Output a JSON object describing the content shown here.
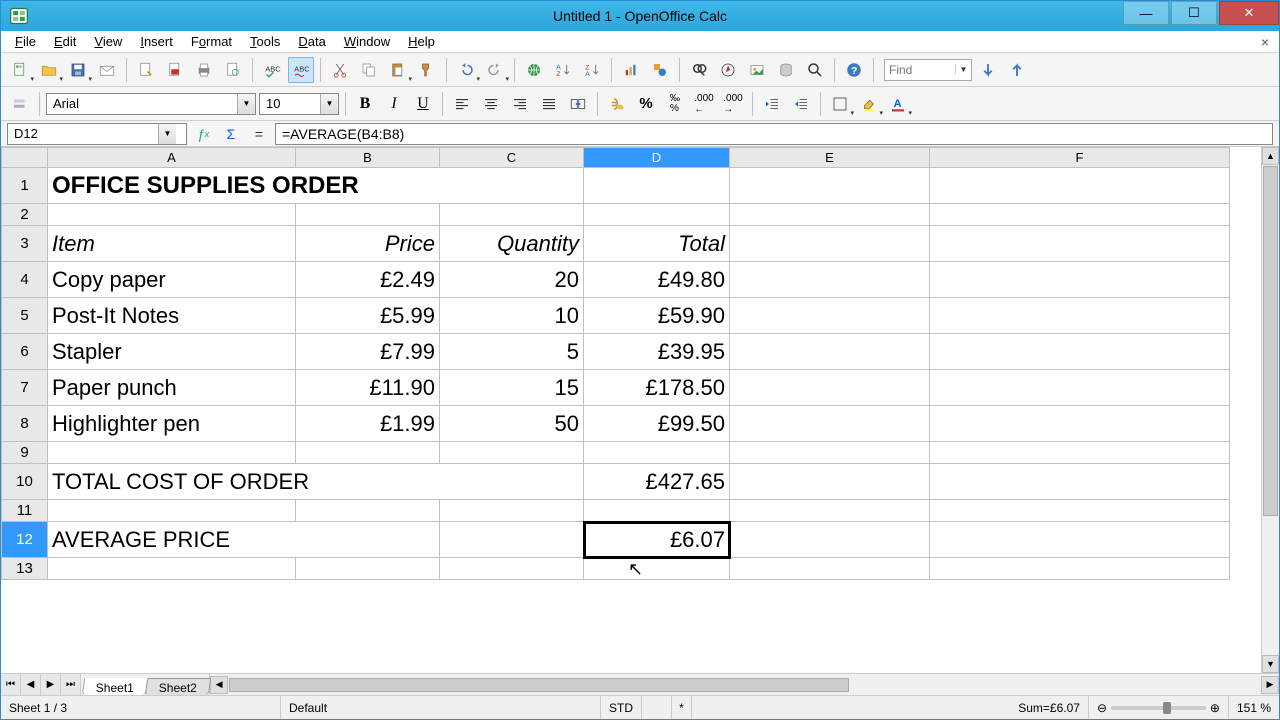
{
  "window": {
    "title": "Untitled 1 - OpenOffice Calc"
  },
  "menus": [
    "File",
    "Edit",
    "View",
    "Insert",
    "Format",
    "Tools",
    "Data",
    "Window",
    "Help"
  ],
  "toolbar": {
    "find_placeholder": "Find"
  },
  "format_bar": {
    "font_name": "Arial",
    "font_size": "10"
  },
  "formula_bar": {
    "cell_ref": "D12",
    "formula": "=AVERAGE(B4:B8)"
  },
  "columns": [
    "A",
    "B",
    "C",
    "D",
    "E",
    "F"
  ],
  "row_numbers": [
    "1",
    "2",
    "3",
    "4",
    "5",
    "6",
    "7",
    "8",
    "9",
    "10",
    "11",
    "12",
    "13"
  ],
  "selected": {
    "col": "D",
    "row": "12"
  },
  "cells": {
    "title": "OFFICE SUPPLIES ORDER",
    "hdr_item": "Item",
    "hdr_price": "Price",
    "hdr_qty": "Quantity",
    "hdr_total": "Total",
    "r4a": "Copy paper",
    "r4b": "£2.49",
    "r4c": "20",
    "r4d": "£49.80",
    "r5a": "Post-It Notes",
    "r5b": "£5.99",
    "r5c": "10",
    "r5d": "£59.90",
    "r6a": "Stapler",
    "r6b": "£7.99",
    "r6c": "5",
    "r6d": "£39.95",
    "r7a": "Paper punch",
    "r7b": "£11.90",
    "r7c": "15",
    "r7d": "£178.50",
    "r8a": "Highlighter pen",
    "r8b": "£1.99",
    "r8c": "50",
    "r8d": "£99.50",
    "r10a": "TOTAL COST OF ORDER",
    "r10d": "£427.65",
    "r12a": "AVERAGE PRICE",
    "r12d": "£6.07"
  },
  "tabs": [
    "Sheet1",
    "Sheet2"
  ],
  "status": {
    "sheet": "Sheet 1 / 3",
    "style": "Default",
    "mode": "STD",
    "mod": "*",
    "sum": "Sum=£6.07",
    "zoom": "151 %"
  }
}
